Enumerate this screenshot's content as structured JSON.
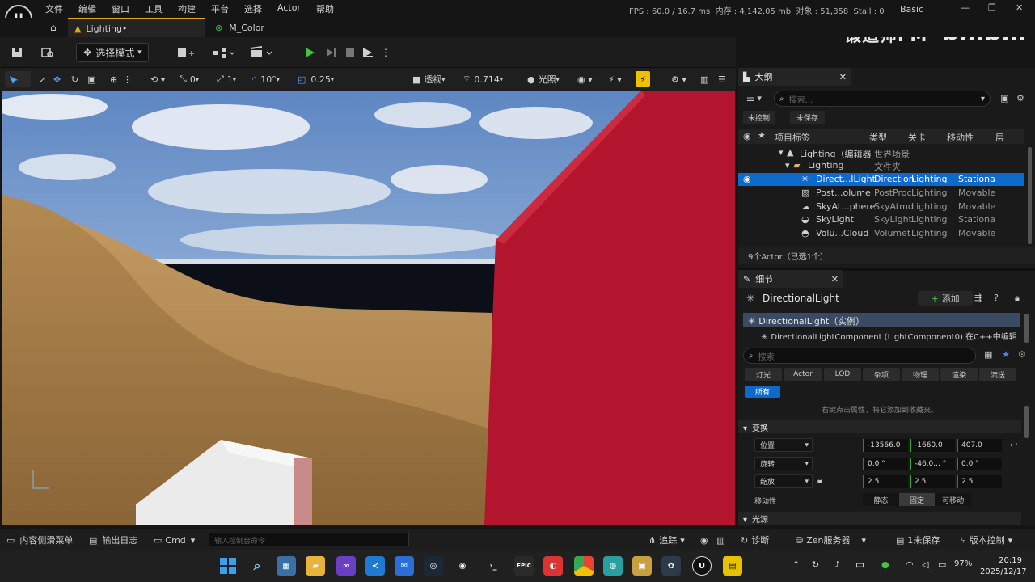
{
  "menu": {
    "items": [
      "文件",
      "编辑",
      "窗口",
      "工具",
      "构建",
      "平台",
      "选择",
      "Actor",
      "帮助"
    ]
  },
  "logo": {
    "label": "U"
  },
  "stats": {
    "text": "FPS : 60.0 / 16.7 ms  内存 : 4,142.05 mb  对象 : 51,858  Stall : 0"
  },
  "layout_preset": "Basic",
  "window_controls": {
    "minimize": "—",
    "restore": "❐",
    "close": "✕"
  },
  "watermark": {
    "text": "锻造师FM",
    "brand": "bilibili"
  },
  "tabs": [
    {
      "label": "Lighting•",
      "icon": "level-icon"
    },
    {
      "label": "M_Color",
      "icon": "material-icon"
    }
  ],
  "toolbar": {
    "mode_label": "选择模式"
  },
  "viewport_toolbar": {
    "location_snap": "0",
    "grid_snap": "1",
    "rotation_snap": "10°",
    "scale_snap": "0.25",
    "view_mode": "透视",
    "camera_speed": "0.714",
    "lighting_mode": "光照"
  },
  "outliner": {
    "title": "大纲",
    "search_placeholder": "搜索...",
    "filters": [
      "未控制",
      "未保存"
    ],
    "columns": {
      "label": "项目标签",
      "type": "类型",
      "level": "关卡",
      "mobility": "移动性",
      "layer": "层"
    },
    "rows": [
      {
        "label": "Lighting（编辑器",
        "type": "世界场景",
        "level": "",
        "mobility": "",
        "selected": false
      },
      {
        "label": "Lighting",
        "type": "文件夹",
        "level": "",
        "mobility": "",
        "selected": false
      },
      {
        "label": "Direct...lLight",
        "type": "Direction",
        "level": "Lighting",
        "mobility": "Stationa",
        "selected": true
      },
      {
        "label": "Post...olume",
        "type": "PostProc",
        "level": "Lighting",
        "mobility": "Movable",
        "selected": false
      },
      {
        "label": "SkyAt...phere",
        "type": "SkyAtmo",
        "level": "Lighting",
        "mobility": "Movable",
        "selected": false
      },
      {
        "label": "SkyLight",
        "type": "SkyLight",
        "level": "Lighting",
        "mobility": "Stationa",
        "selected": false
      },
      {
        "label": "Volu...Cloud",
        "type": "Volumet",
        "level": "Lighting",
        "mobility": "Movable",
        "selected": false
      }
    ],
    "footer": "9个Actor（已选1个）"
  },
  "details": {
    "title": "细节",
    "actor_name": "DirectionalLight",
    "add_label": "添加",
    "instance_label": "DirectionalLight（实例）",
    "component_label": "DirectionalLightComponent (LightComponent0)  在C++中编辑",
    "search_placeholder": "搜索",
    "filter_tabs": [
      "灯光",
      "Actor",
      "LOD",
      "杂项",
      "物理",
      "渲染",
      "流送"
    ],
    "all_label": "所有",
    "hint": "右键点击属性，将它添加到收藏夹。",
    "transform_section": "变换",
    "location_label": "位置",
    "location": [
      "-13566.0",
      "-1660.0",
      "407.0"
    ],
    "rotation_label": "旋转",
    "rotation": [
      "0.0 °",
      "-46.0... °",
      "0.0 °"
    ],
    "scale_label": "缩放",
    "scale": [
      "2.5",
      "2.5",
      "2.5"
    ],
    "mobility_label": "移动性",
    "mobility_options": [
      "静态",
      "固定",
      "可移动"
    ],
    "mobility_selected": "固定",
    "light_section": "光源"
  },
  "statusbar": {
    "content_drawer": "内容侧滑菜单",
    "output_log": "输出日志",
    "cmd": "Cmd",
    "console_placeholder": "输入控制台命令",
    "trace": "追踪",
    "diagnostics": "诊断",
    "zen": "Zen服务器",
    "unsaved": "1未保存",
    "source_control": "版本控制"
  },
  "taskbar": {
    "ime": "中",
    "battery": "97%",
    "time": "20:19",
    "date": "2025/12/17",
    "unreal_label": "U",
    "epic_label": "EPIC"
  },
  "colors": {
    "accent": "#e8a317",
    "selection": "#0d6acb",
    "play": "#3ec63e"
  }
}
